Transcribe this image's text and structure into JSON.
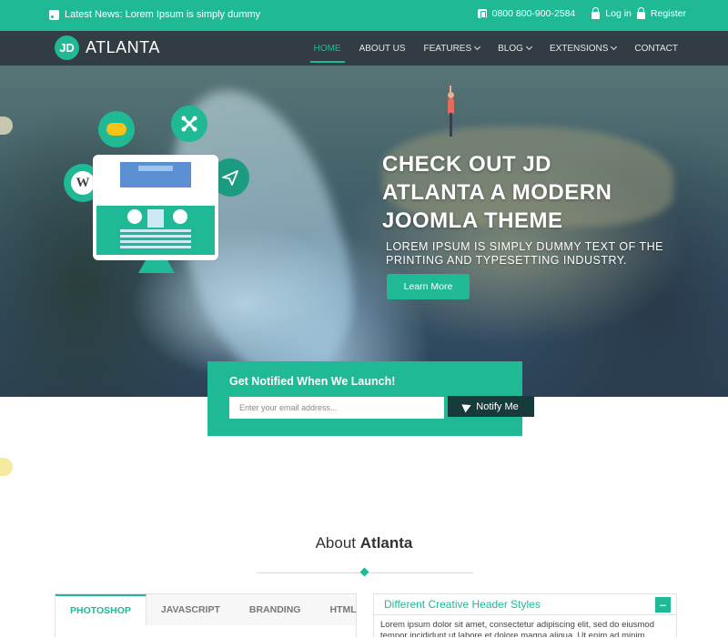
{
  "topbar": {
    "news": "Latest News: Lorem Ipsum is simply dummy",
    "phone": "0800 800-900-2584",
    "login": "Log in",
    "register": "Register"
  },
  "logo": {
    "mark": "JD",
    "name": "ATLANTA"
  },
  "nav": {
    "items": [
      {
        "label": "HOME",
        "active": true
      },
      {
        "label": "ABOUT US"
      },
      {
        "label": "FEATURES",
        "dropdown": true
      },
      {
        "label": "BLOG",
        "dropdown": true
      },
      {
        "label": "EXTENSIONS",
        "dropdown": true
      },
      {
        "label": "CONTACT"
      }
    ]
  },
  "hero": {
    "title_line1": "CHECK OUT JD",
    "title_line2": "ATLANTA A MODERN",
    "title_line3": "JOOMLA THEME",
    "subtitle": "Lorem Ipsum is simply dummy text of the printing and typesetting industry.",
    "button": "Learn More",
    "illustration_icons": [
      "cloud-icon",
      "joomla-icon",
      "wordpress-icon",
      "paper-plane-icon",
      "monitor-icon"
    ]
  },
  "notify": {
    "title": "Get Notified When We Launch!",
    "placeholder": "Enter your email address...",
    "button": "Notify Me"
  },
  "about": {
    "title_plain": "About",
    "title_bold": "Atlanta"
  },
  "tabs": {
    "items": [
      "PHOTOSHOP",
      "JAVASCRIPT",
      "BRANDING",
      "HTML"
    ],
    "active": "PHOTOSHOP"
  },
  "accordion": {
    "header": "Different Creative Header Styles",
    "toggle": "–",
    "body": "Lorem ipsum dolor sit amet, consectetur adipiscing elit, sed do eiusmod tempor incididunt ut labore et dolore magna aliqua. Ut enim ad minim veniam,"
  },
  "colors": {
    "accent": "#1fb996",
    "dark_button": "#173b3b",
    "navbar": "#262d34"
  }
}
